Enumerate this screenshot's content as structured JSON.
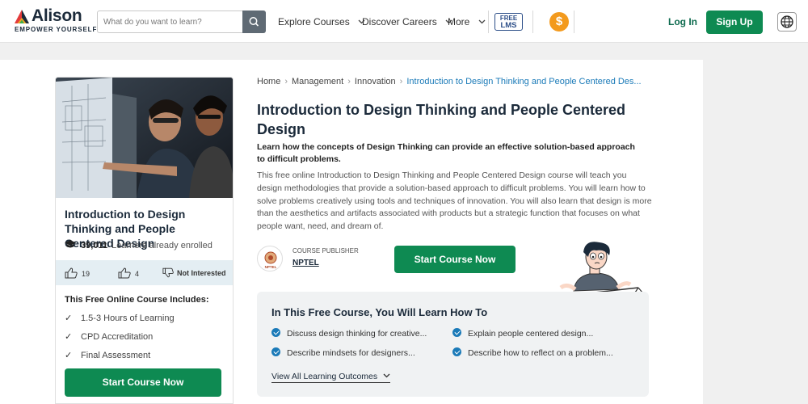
{
  "header": {
    "logo_text": "Alison",
    "logo_tagline": "EMPOWER YOURSELF",
    "search_placeholder": "What do you want to learn?",
    "nav": [
      "Explore Courses",
      "Discover Careers",
      "More"
    ],
    "free_lms": [
      "FREE",
      "LMS"
    ],
    "coin_symbol": "$",
    "login": "Log In",
    "signup": "Sign Up"
  },
  "card": {
    "title": "Introduction to Design Thinking and People Centered Design",
    "enrolled_count": "39,011",
    "enrolled_text": "Learners already enrolled",
    "likes": "19",
    "hearts": "4",
    "not_interested": "Not Interested",
    "includes_title": "This Free Online Course Includes:",
    "includes": [
      "1.5-3 Hours of Learning",
      "CPD Accreditation",
      "Final Assessment"
    ],
    "cta": "Start Course Now"
  },
  "breadcrumb": [
    "Home",
    "Management",
    "Innovation",
    "Introduction to Design Thinking and People Centered Des..."
  ],
  "course": {
    "title": "Introduction to Design Thinking and People Centered Design",
    "subtitle": "Learn how the concepts of Design Thinking can provide an effective solution-based approach to difficult problems.",
    "description": "This free online Introduction to Design Thinking and People Centered Design course will teach you design methodologies that provide a solution-based approach to difficult problems. You will learn how to solve problems creatively using tools and techniques of innovation. You will also learn that design is more than the aesthetics and artifacts associated with products but a strategic function that focuses on what people want, need, and dream of.",
    "publisher_label": "COURSE PUBLISHER",
    "publisher_name": "NPTEL",
    "publisher_logo_text": "NPTEL",
    "cta": "Start Course Now"
  },
  "learn": {
    "title": "In This Free Course, You Will Learn How To",
    "outcomes": [
      "Discuss design thinking for creative...",
      "Explain people centered design...",
      "Describe mindsets for designers...",
      "Describe how to reflect on a problem..."
    ],
    "view_all": "View All Learning Outcomes"
  },
  "colors": {
    "brand_green": "#0e8a52",
    "link_blue": "#1a7ab8",
    "coin_orange": "#f39a1d",
    "lms_blue": "#2c4e88"
  },
  "icons": [
    "search-icon",
    "chevron-down-icon",
    "coin-icon",
    "globe-icon",
    "graduation-cap-icon",
    "thumbs-up-icon",
    "heart-icon",
    "thumbs-down-icon",
    "check-icon",
    "check-circle-icon"
  ]
}
